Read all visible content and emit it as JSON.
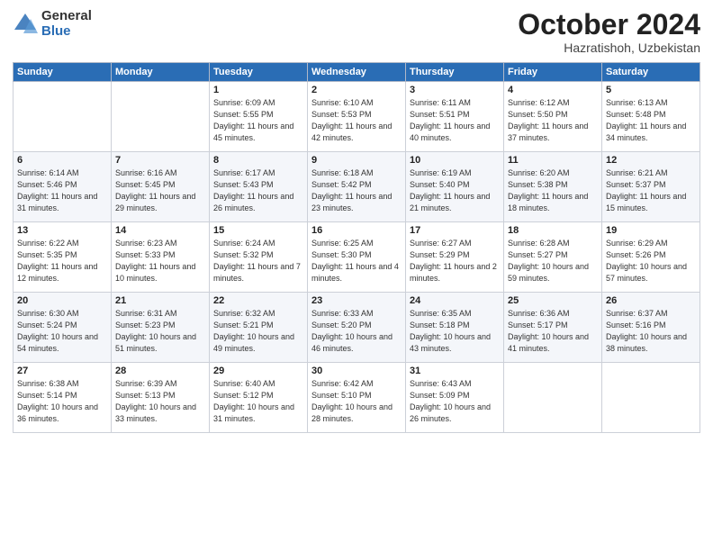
{
  "logo": {
    "general": "General",
    "blue": "Blue"
  },
  "title": {
    "month": "October 2024",
    "location": "Hazratishoh, Uzbekistan"
  },
  "weekdays": [
    "Sunday",
    "Monday",
    "Tuesday",
    "Wednesday",
    "Thursday",
    "Friday",
    "Saturday"
  ],
  "weeks": [
    [
      {
        "day": "",
        "info": ""
      },
      {
        "day": "",
        "info": ""
      },
      {
        "day": "1",
        "info": "Sunrise: 6:09 AM\nSunset: 5:55 PM\nDaylight: 11 hours and 45 minutes."
      },
      {
        "day": "2",
        "info": "Sunrise: 6:10 AM\nSunset: 5:53 PM\nDaylight: 11 hours and 42 minutes."
      },
      {
        "day": "3",
        "info": "Sunrise: 6:11 AM\nSunset: 5:51 PM\nDaylight: 11 hours and 40 minutes."
      },
      {
        "day": "4",
        "info": "Sunrise: 6:12 AM\nSunset: 5:50 PM\nDaylight: 11 hours and 37 minutes."
      },
      {
        "day": "5",
        "info": "Sunrise: 6:13 AM\nSunset: 5:48 PM\nDaylight: 11 hours and 34 minutes."
      }
    ],
    [
      {
        "day": "6",
        "info": "Sunrise: 6:14 AM\nSunset: 5:46 PM\nDaylight: 11 hours and 31 minutes."
      },
      {
        "day": "7",
        "info": "Sunrise: 6:16 AM\nSunset: 5:45 PM\nDaylight: 11 hours and 29 minutes."
      },
      {
        "day": "8",
        "info": "Sunrise: 6:17 AM\nSunset: 5:43 PM\nDaylight: 11 hours and 26 minutes."
      },
      {
        "day": "9",
        "info": "Sunrise: 6:18 AM\nSunset: 5:42 PM\nDaylight: 11 hours and 23 minutes."
      },
      {
        "day": "10",
        "info": "Sunrise: 6:19 AM\nSunset: 5:40 PM\nDaylight: 11 hours and 21 minutes."
      },
      {
        "day": "11",
        "info": "Sunrise: 6:20 AM\nSunset: 5:38 PM\nDaylight: 11 hours and 18 minutes."
      },
      {
        "day": "12",
        "info": "Sunrise: 6:21 AM\nSunset: 5:37 PM\nDaylight: 11 hours and 15 minutes."
      }
    ],
    [
      {
        "day": "13",
        "info": "Sunrise: 6:22 AM\nSunset: 5:35 PM\nDaylight: 11 hours and 12 minutes."
      },
      {
        "day": "14",
        "info": "Sunrise: 6:23 AM\nSunset: 5:33 PM\nDaylight: 11 hours and 10 minutes."
      },
      {
        "day": "15",
        "info": "Sunrise: 6:24 AM\nSunset: 5:32 PM\nDaylight: 11 hours and 7 minutes."
      },
      {
        "day": "16",
        "info": "Sunrise: 6:25 AM\nSunset: 5:30 PM\nDaylight: 11 hours and 4 minutes."
      },
      {
        "day": "17",
        "info": "Sunrise: 6:27 AM\nSunset: 5:29 PM\nDaylight: 11 hours and 2 minutes."
      },
      {
        "day": "18",
        "info": "Sunrise: 6:28 AM\nSunset: 5:27 PM\nDaylight: 10 hours and 59 minutes."
      },
      {
        "day": "19",
        "info": "Sunrise: 6:29 AM\nSunset: 5:26 PM\nDaylight: 10 hours and 57 minutes."
      }
    ],
    [
      {
        "day": "20",
        "info": "Sunrise: 6:30 AM\nSunset: 5:24 PM\nDaylight: 10 hours and 54 minutes."
      },
      {
        "day": "21",
        "info": "Sunrise: 6:31 AM\nSunset: 5:23 PM\nDaylight: 10 hours and 51 minutes."
      },
      {
        "day": "22",
        "info": "Sunrise: 6:32 AM\nSunset: 5:21 PM\nDaylight: 10 hours and 49 minutes."
      },
      {
        "day": "23",
        "info": "Sunrise: 6:33 AM\nSunset: 5:20 PM\nDaylight: 10 hours and 46 minutes."
      },
      {
        "day": "24",
        "info": "Sunrise: 6:35 AM\nSunset: 5:18 PM\nDaylight: 10 hours and 43 minutes."
      },
      {
        "day": "25",
        "info": "Sunrise: 6:36 AM\nSunset: 5:17 PM\nDaylight: 10 hours and 41 minutes."
      },
      {
        "day": "26",
        "info": "Sunrise: 6:37 AM\nSunset: 5:16 PM\nDaylight: 10 hours and 38 minutes."
      }
    ],
    [
      {
        "day": "27",
        "info": "Sunrise: 6:38 AM\nSunset: 5:14 PM\nDaylight: 10 hours and 36 minutes."
      },
      {
        "day": "28",
        "info": "Sunrise: 6:39 AM\nSunset: 5:13 PM\nDaylight: 10 hours and 33 minutes."
      },
      {
        "day": "29",
        "info": "Sunrise: 6:40 AM\nSunset: 5:12 PM\nDaylight: 10 hours and 31 minutes."
      },
      {
        "day": "30",
        "info": "Sunrise: 6:42 AM\nSunset: 5:10 PM\nDaylight: 10 hours and 28 minutes."
      },
      {
        "day": "31",
        "info": "Sunrise: 6:43 AM\nSunset: 5:09 PM\nDaylight: 10 hours and 26 minutes."
      },
      {
        "day": "",
        "info": ""
      },
      {
        "day": "",
        "info": ""
      }
    ]
  ]
}
